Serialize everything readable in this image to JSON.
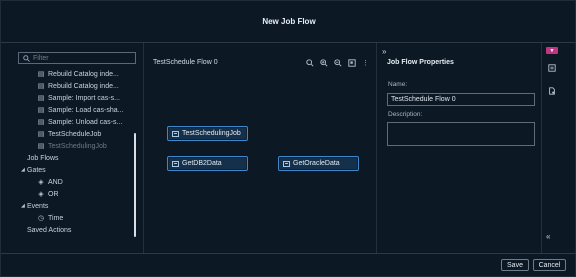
{
  "dialog": {
    "title": "New Job Flow"
  },
  "filter": {
    "placeholder": "Filter"
  },
  "tree": [
    {
      "label": "Rebuild Catalog inde...",
      "type": "job"
    },
    {
      "label": "Rebuild Catalog inde...",
      "type": "job"
    },
    {
      "label": "Sample: Import cas-s...",
      "type": "job"
    },
    {
      "label": "Sample: Load cas-sha...",
      "type": "job"
    },
    {
      "label": "Sample: Unload cas-s...",
      "type": "job"
    },
    {
      "label": "TestScheduleJob",
      "type": "job"
    },
    {
      "label": "TestSchedulingJob",
      "type": "job",
      "muted": true
    },
    {
      "label": "Job Flows",
      "type": "category"
    },
    {
      "label": "Gates",
      "type": "group"
    },
    {
      "label": "AND",
      "type": "gate"
    },
    {
      "label": "OR",
      "type": "gate"
    },
    {
      "label": "Events",
      "type": "group"
    },
    {
      "label": "Time",
      "type": "event"
    },
    {
      "label": "Saved Actions",
      "type": "category"
    }
  ],
  "canvas": {
    "title": "TestSchedule Flow 0",
    "nodes": [
      "TestSchedulingJob",
      "GetDB2Data",
      "GetOracleData"
    ]
  },
  "properties": {
    "title": "Job Flow Properties",
    "name_label": "Name:",
    "name_value": "TestSchedule Flow 0",
    "description_label": "Description:",
    "description_value": ""
  },
  "footer": {
    "save": "Save",
    "cancel": "Cancel"
  },
  "colors": {
    "accent": "#3f87c9",
    "pin": "#c0357f",
    "background": "#0c1824"
  }
}
